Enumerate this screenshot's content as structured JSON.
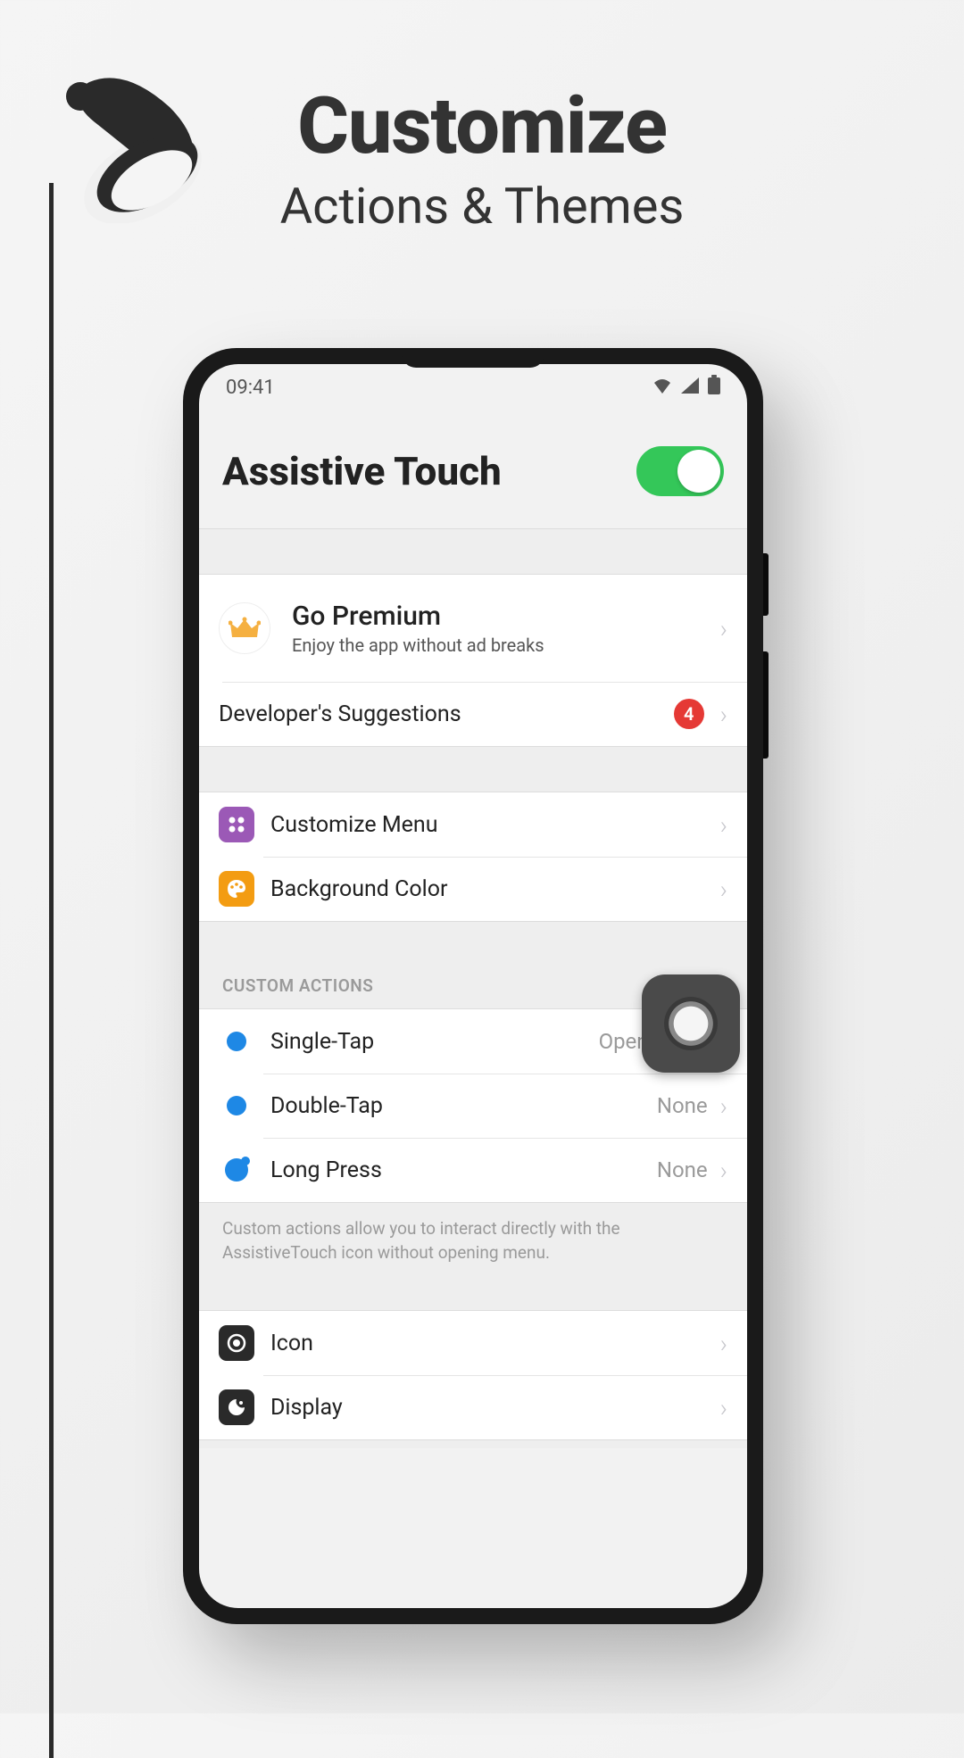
{
  "headline": {
    "title": "Customize",
    "subtitle": "Actions & Themes"
  },
  "status_bar": {
    "time": "09:41"
  },
  "header": {
    "title": "Assistive Touch",
    "toggle_on": true
  },
  "premium": {
    "title": "Go Premium",
    "subtitle": "Enjoy the app without ad breaks"
  },
  "dev_suggestions": {
    "label": "Developer's Suggestions",
    "badge": "4"
  },
  "customize": {
    "menu_label": "Customize Menu",
    "bg_color_label": "Background Color"
  },
  "custom_actions": {
    "section_title": "CUSTOM ACTIONS",
    "items": [
      {
        "label": "Single-Tap",
        "value": "Open Menu"
      },
      {
        "label": "Double-Tap",
        "value": "None"
      },
      {
        "label": "Long Press",
        "value": "None"
      }
    ],
    "footer": "Custom actions allow you to interact directly with the AssistiveTouch icon without opening menu."
  },
  "appearance": {
    "icon_label": "Icon",
    "display_label": "Display"
  }
}
